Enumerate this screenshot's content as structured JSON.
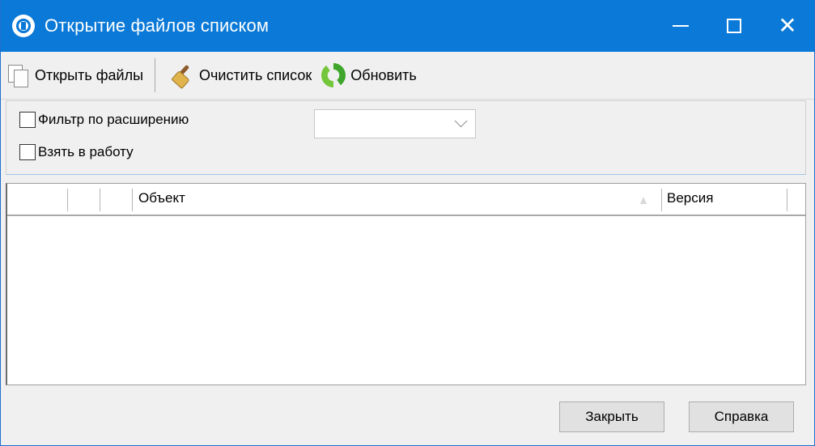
{
  "window": {
    "title": "Открытие файлов списком"
  },
  "toolbar": {
    "open_files": "Открыть файлы",
    "clear_list": "Очистить список",
    "refresh": "Обновить"
  },
  "options": {
    "filter_by_extension": {
      "label": "Фильтр по расширению",
      "checked": false
    },
    "take_to_work": {
      "label": "Взять в работу",
      "checked": false
    },
    "extension_combo": {
      "value": ""
    }
  },
  "grid": {
    "columns": [
      "",
      "",
      "Объект",
      "Версия"
    ],
    "sorted_column": "Объект",
    "rows": []
  },
  "footer": {
    "close_label": "Закрыть",
    "help_label": "Справка"
  }
}
